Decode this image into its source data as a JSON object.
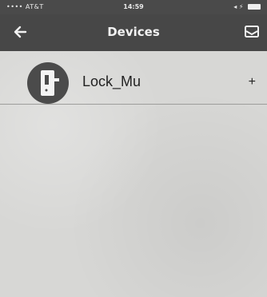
{
  "status_bar": {
    "carrier": "•••• AT&T",
    "time": "14:59",
    "battery_text": "◂ ⚡"
  },
  "nav": {
    "title": "Devices",
    "back_icon": "arrow-left-icon",
    "mail_icon": "envelope-icon"
  },
  "devices": [
    {
      "name": "Lock_Mu",
      "action": "+"
    }
  ],
  "colors": {
    "nav_bg": "#474747",
    "content_bg": "#d7d7d5",
    "avatar_bg": "#4b4b4b"
  }
}
